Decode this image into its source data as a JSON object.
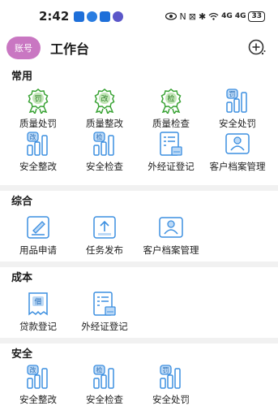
{
  "status": {
    "time": "2:42",
    "notification_icons": [
      "app-icon",
      "cloud-icon",
      "app-icon",
      "circle-icon"
    ],
    "status_text": [
      "N",
      "⊠",
      "✱",
      "4G",
      "4G"
    ],
    "battery": "33"
  },
  "header": {
    "avatar_label": "账号",
    "title": "工作台"
  },
  "sections": [
    {
      "title": "常用",
      "items": [
        {
          "label": "质量处罚",
          "icon": "award-penalty-icon",
          "badge": "罚"
        },
        {
          "label": "质量整改",
          "icon": "award-rectify-icon",
          "badge": "改"
        },
        {
          "label": "质量检查",
          "icon": "award-check-icon",
          "badge": "检"
        },
        {
          "label": "安全处罚",
          "icon": "chart-penalty-icon",
          "badge": "罚"
        },
        {
          "label": "安全整改",
          "icon": "chart-rectify-icon",
          "badge": "改"
        },
        {
          "label": "安全检查",
          "icon": "chart-check-icon",
          "badge": "检"
        },
        {
          "label": "外经证登记",
          "icon": "form-register-icon",
          "badge": ""
        },
        {
          "label": "客户档案管理",
          "icon": "customer-card-icon",
          "badge": ""
        }
      ]
    },
    {
      "title": "综合",
      "items": [
        {
          "label": "用品申请",
          "icon": "edit-document-icon",
          "badge": ""
        },
        {
          "label": "任务发布",
          "icon": "upload-document-icon",
          "badge": ""
        },
        {
          "label": "客户档案管理",
          "icon": "customer-card-icon",
          "badge": ""
        }
      ]
    },
    {
      "title": "成本",
      "items": [
        {
          "label": "贷款登记",
          "icon": "loan-receipt-icon",
          "badge": "借"
        },
        {
          "label": "外经证登记",
          "icon": "form-register-icon",
          "badge": ""
        }
      ]
    },
    {
      "title": "安全",
      "items": [
        {
          "label": "安全整改",
          "icon": "chart-rectify-icon",
          "badge": "改"
        },
        {
          "label": "安全检查",
          "icon": "chart-check-icon",
          "badge": "检"
        },
        {
          "label": "安全处罚",
          "icon": "chart-penalty-icon",
          "badge": "罚"
        }
      ]
    }
  ],
  "colors": {
    "green": "#3aa335",
    "blue": "#3c8fe0",
    "avatar": "#c977c2"
  }
}
